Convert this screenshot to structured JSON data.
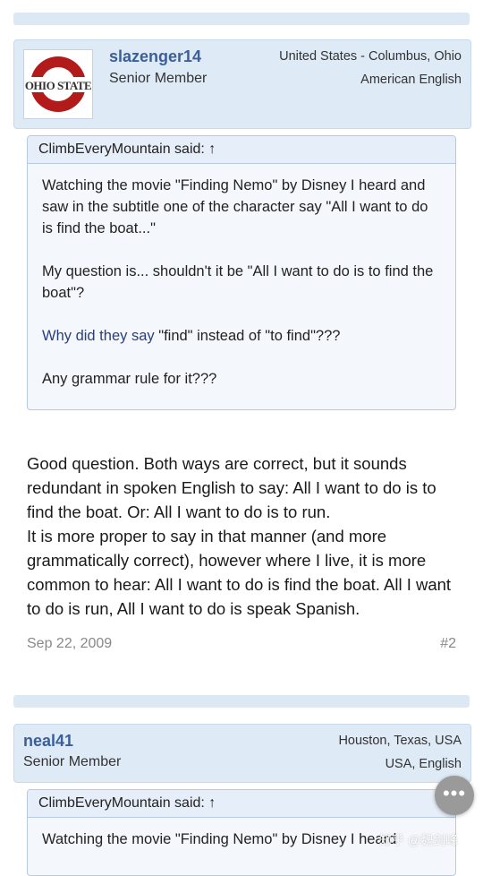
{
  "post1": {
    "username": "slazenger14",
    "role": "Senior Member",
    "location": "United States - Columbus, Ohio",
    "language": "American English",
    "avatar_logo_text": "OHIO STATE",
    "quote": {
      "header": "ClimbEveryMountain said: ↑",
      "p1": "Watching the movie \"Finding Nemo\" by Disney I heard and saw in the subtitle one of the character say \"All I want to do is find the boat...\"",
      "p2": "My question is... shouldn't it be \"All I want to do is to find the boat\"?",
      "p3_link": "Why did they say",
      "p3_rest": " \"find\" instead of \"to find\"???",
      "p4": "Any grammar rule for it???"
    },
    "message_p1": "Good question. Both ways are correct, but it sounds redundant in spoken English to say: All I want to do is to find the boat. Or: All I want to do is to run.",
    "message_p2": "It is more proper to say in that manner (and more grammatically correct), however where I live, it is more common to hear: All I want to do is find the boat. All I want to do is run, All I want to do is speak Spanish.",
    "date": "Sep 22, 2009",
    "post_number": "#2"
  },
  "post2": {
    "username": "neal41",
    "role": "Senior Member",
    "location": "Houston, Texas, USA",
    "language": "USA, English",
    "quote": {
      "header": "ClimbEveryMountain said: ↑",
      "p1": "Watching the movie \"Finding Nemo\" by Disney I heard"
    }
  },
  "overlay": {
    "fab_label": "•••",
    "watermark": "知乎 @魏剑峰"
  },
  "colors": {
    "header_bg": "#dfeaf7",
    "username": "#3b5f99",
    "quote_border": "#b9cae0",
    "separator": "#dce8f4"
  }
}
